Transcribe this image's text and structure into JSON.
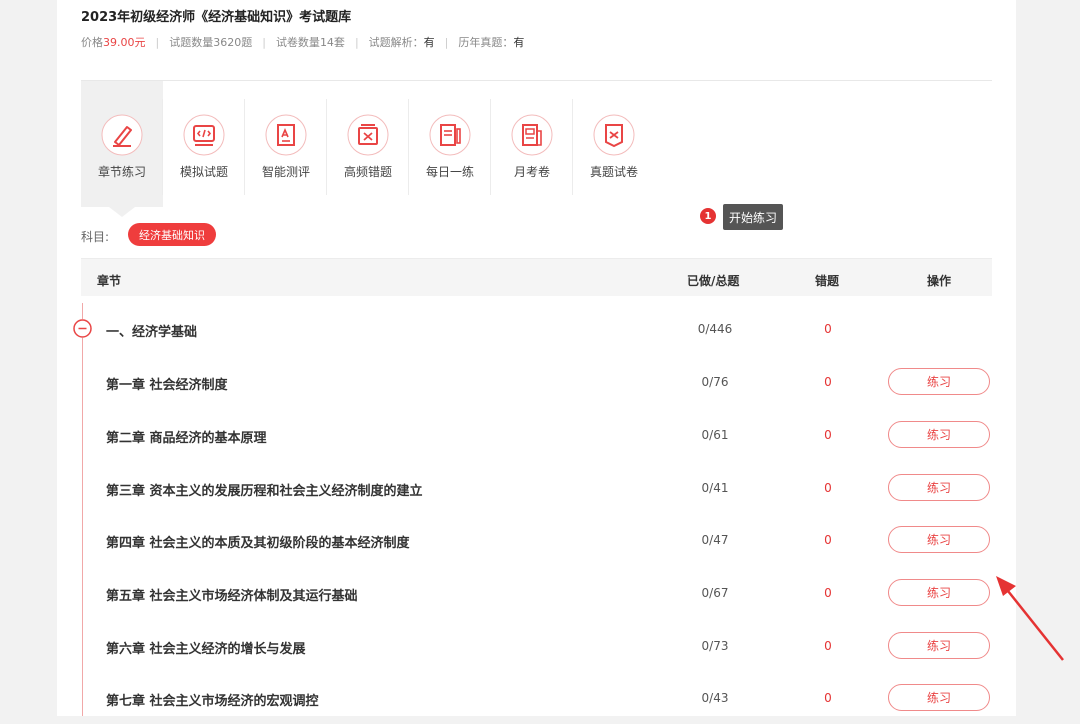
{
  "header": {
    "title": "2023年初级经济师《经济基础知识》考试题库",
    "price_label": "价格",
    "price_value": "39.00元",
    "question_count_label": "试题数量",
    "question_count_value": "3620题",
    "paper_count_label": "试卷数量",
    "paper_count_value": "14套",
    "analysis_label": "试题解析：",
    "analysis_value": "有",
    "past_exam_label": "历年真题：",
    "past_exam_value": "有"
  },
  "tabs": [
    {
      "label": "章节练习",
      "icon": "pencil-icon",
      "active": true
    },
    {
      "label": "模拟试题",
      "icon": "code-icon",
      "active": false
    },
    {
      "label": "智能测评",
      "icon": "assessment-icon",
      "active": false
    },
    {
      "label": "高频错题",
      "icon": "wrong-questions-icon",
      "active": false
    },
    {
      "label": "每日一练",
      "icon": "daily-practice-icon",
      "active": false
    },
    {
      "label": "月考卷",
      "icon": "monthly-paper-icon",
      "active": false
    },
    {
      "label": "真题试卷",
      "icon": "real-exam-icon",
      "active": false
    }
  ],
  "subject": {
    "label": "科目:",
    "selected": "经济基础知识"
  },
  "tooltip": {
    "number": "1",
    "text": "开始练习"
  },
  "table": {
    "headers": {
      "chapter": "章节",
      "done_total": "已做/总题",
      "wrong": "错题",
      "action": "操作"
    },
    "section": {
      "title": "一、经济学基础",
      "done_total": "0/446",
      "wrong": "0"
    },
    "rows": [
      {
        "name": "第一章 社会经济制度",
        "done_total": "0/76",
        "wrong": "0",
        "action": "练习"
      },
      {
        "name": "第二章 商品经济的基本原理",
        "done_total": "0/61",
        "wrong": "0",
        "action": "练习"
      },
      {
        "name": "第三章 资本主义的发展历程和社会主义经济制度的建立",
        "done_total": "0/41",
        "wrong": "0",
        "action": "练习"
      },
      {
        "name": "第四章 社会主义的本质及其初级阶段的基本经济制度",
        "done_total": "0/47",
        "wrong": "0",
        "action": "练习"
      },
      {
        "name": "第五章 社会主义市场经济体制及其运行基础",
        "done_total": "0/67",
        "wrong": "0",
        "action": "练习"
      },
      {
        "name": "第六章 社会主义经济的增长与发展",
        "done_total": "0/73",
        "wrong": "0",
        "action": "练习"
      },
      {
        "name": "第七章 社会主义市场经济的宏观调控",
        "done_total": "0/43",
        "wrong": "0",
        "action": "练习"
      }
    ]
  },
  "colors": {
    "accent": "#e94545",
    "chip": "#ef3d3d",
    "tooltip_bg": "#555555"
  }
}
